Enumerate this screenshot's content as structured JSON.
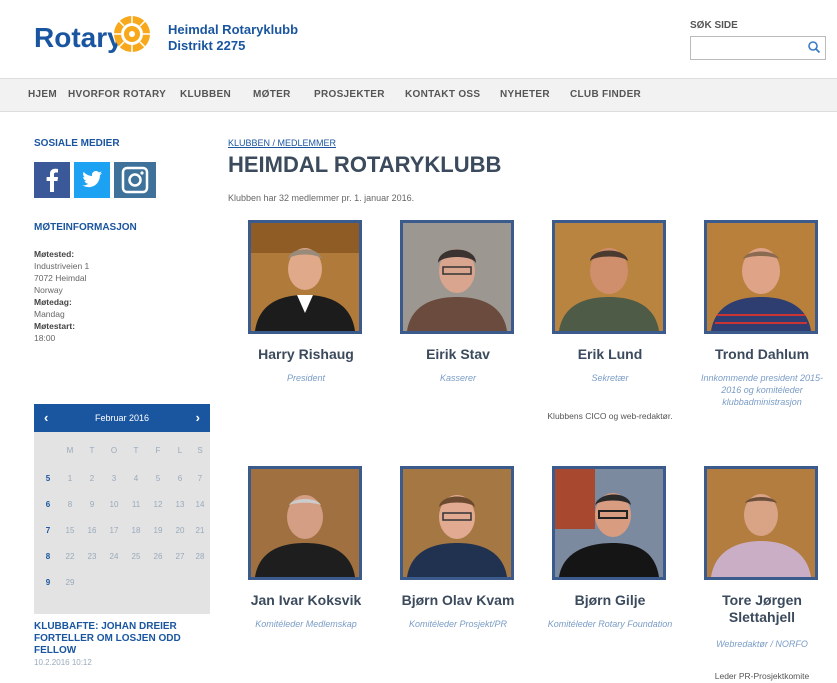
{
  "header": {
    "logo": "Rotary",
    "club_name": "Heimdal Rotaryklubb",
    "district": "Distrikt 2275",
    "search_label": "SØK SIDE",
    "search_value": ""
  },
  "nav": [
    "HJEM",
    "HVORFOR ROTARY",
    "KLUBBEN",
    "MØTER",
    "PROSJEKTER",
    "KONTAKT OSS",
    "NYHETER",
    "CLUB FINDER"
  ],
  "sidebar": {
    "social_heading": "SOSIALE MEDIER",
    "social_icons": [
      "facebook-icon",
      "twitter-icon",
      "instagram-icon"
    ],
    "meeting_heading": "MØTEINFORMASJON",
    "meeting_place_label": "Møtested:",
    "meeting_place": [
      "Industriveien 1",
      "7072 Heimdal",
      "Norway"
    ],
    "meeting_day_label": "Møtedag:",
    "meeting_day": "Mandag",
    "meeting_start_label": "Møtestart:",
    "meeting_start": "18:00",
    "calendar": {
      "title": "Februar 2016",
      "days": [
        "M",
        "T",
        "O",
        "T",
        "F",
        "L",
        "S"
      ],
      "rows": [
        [
          "5",
          "1",
          "2",
          "3",
          "4",
          "5",
          "6",
          "7"
        ],
        [
          "6",
          "8",
          "9",
          "10",
          "11",
          "12",
          "13",
          "14"
        ],
        [
          "7",
          "15",
          "16",
          "17",
          "18",
          "19",
          "20",
          "21"
        ],
        [
          "8",
          "22",
          "23",
          "24",
          "25",
          "26",
          "27",
          "28"
        ],
        [
          "9",
          "29",
          "",
          "",
          "",
          "",
          "",
          ""
        ]
      ]
    },
    "news_title": "KLUBBAFTE: JOHAN DREIER FORTELLER OM LOSJEN ODD FELLOW",
    "news_date": "10.2.2016 10:12"
  },
  "main": {
    "breadcrumb": "KLUBBEN / MEDLEMMER",
    "title": "HEIMDAL ROTARYKLUBB",
    "intro": "Klubben har 32 medlemmer pr. 1. januar 2016.",
    "members": [
      {
        "name": "Harry Rishaug",
        "role": "President",
        "note": ""
      },
      {
        "name": "Eirik Stav",
        "role": "Kasserer",
        "note": ""
      },
      {
        "name": "Erik Lund",
        "role": "Sekretær",
        "note": "Klubbens CICO og web-redaktør."
      },
      {
        "name": "Trond Dahlum",
        "role": "Innkommende president 2015-2016 og komitéleder klubbadministrasjon",
        "note": ""
      },
      {
        "name": "Jan Ivar Koksvik",
        "role": "Komitéleder Medlemskap",
        "note": ""
      },
      {
        "name": "Bjørn Olav Kvam",
        "role": "Komitéleder Prosjekt/PR",
        "note": ""
      },
      {
        "name": "Bjørn Gilje",
        "role": "Komitéleder Rotary Foundation",
        "note": ""
      },
      {
        "name": "Tore Jørgen Slettahjell",
        "role": "Webredaktør / NORFO",
        "note": "Leder PR-Prosjektkomite"
      }
    ]
  }
}
